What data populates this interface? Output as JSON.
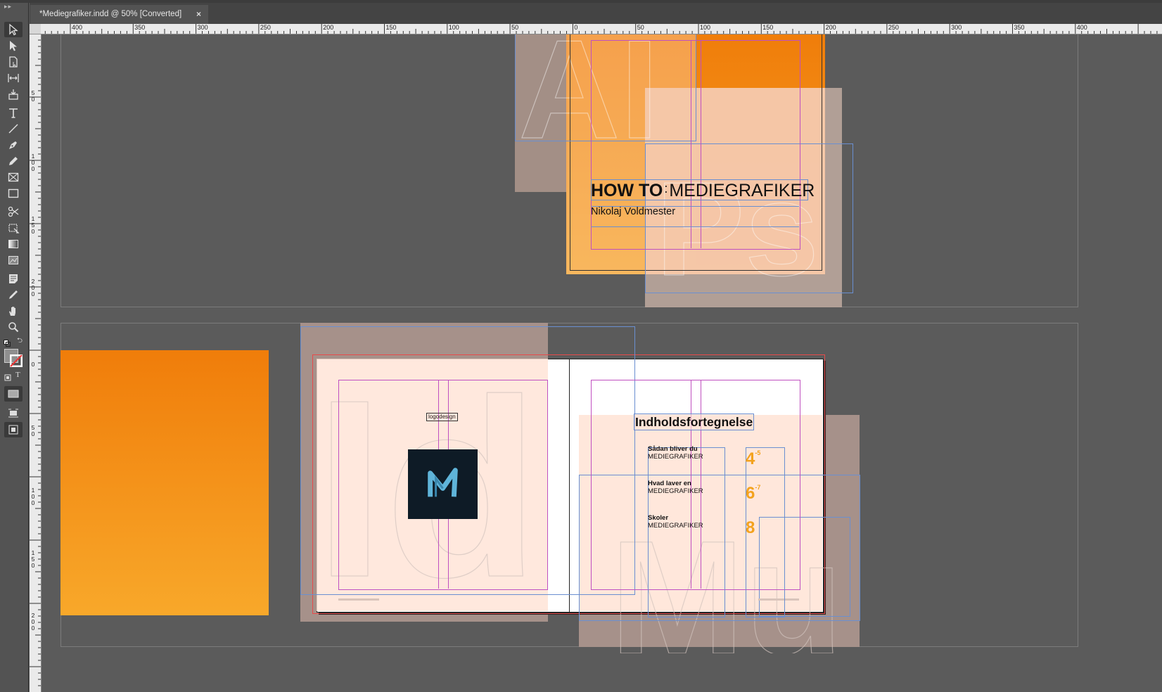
{
  "document": {
    "tab_title": "*Mediegrafiker.indd @ 50% [Converted]",
    "close_glyph": "×"
  },
  "ruler": {
    "horizontal_labels": [
      "400",
      "350",
      "300",
      "250",
      "200",
      "150",
      "100",
      "50",
      "0",
      "50",
      "100",
      "150",
      "200",
      "250",
      "300",
      "350",
      "400"
    ],
    "vertical_labels": [
      "50",
      "100",
      "150",
      "200",
      "0",
      "50",
      "100",
      "150",
      "200"
    ]
  },
  "toolbox": {
    "tools": [
      "selection-tool",
      "direct-selection-tool",
      "page-tool",
      "gap-tool",
      "content-collector-tool",
      "type-tool",
      "line-tool",
      "pen-tool",
      "pencil-tool",
      "rectangle-frame-tool",
      "rectangle-tool",
      "scissors-tool",
      "free-transform-tool",
      "gradient-swatch-tool",
      "gradient-feather-tool",
      "note-tool",
      "eyedropper-tool",
      "hand-tool",
      "zoom-tool"
    ],
    "format_letter": "T"
  },
  "cover": {
    "title_bold": "HOW TO",
    "title_sep": ":",
    "title_light": "MEDIEGRAFIKER",
    "author": "Nikolaj Voldmester"
  },
  "left_page": {
    "logo_label": "logodesign"
  },
  "toc": {
    "heading": "Indholdsfortegnelse",
    "entries": [
      {
        "line1": "Sådan bliver du",
        "line2": "MEDIEGRAFIKER",
        "page": "4",
        "sup": "-5"
      },
      {
        "line1": "Hvad laver en",
        "line2": "MEDIEGRAFIKER",
        "page": "6",
        "sup": "-7"
      },
      {
        "line1": "Skoler",
        "line2": "MEDIEGRAFIKER",
        "page": "8",
        "sup": ""
      }
    ]
  },
  "colors": {
    "accent_orange": "#f07d0a",
    "page_number_orange": "#f3a21e",
    "frame_blue": "#6a8fd1",
    "margin_magenta": "#c050c0",
    "bleed_red": "#e84a4a",
    "logo_bg": "#0e1b26",
    "logo_fg": "#5fb4d9"
  }
}
